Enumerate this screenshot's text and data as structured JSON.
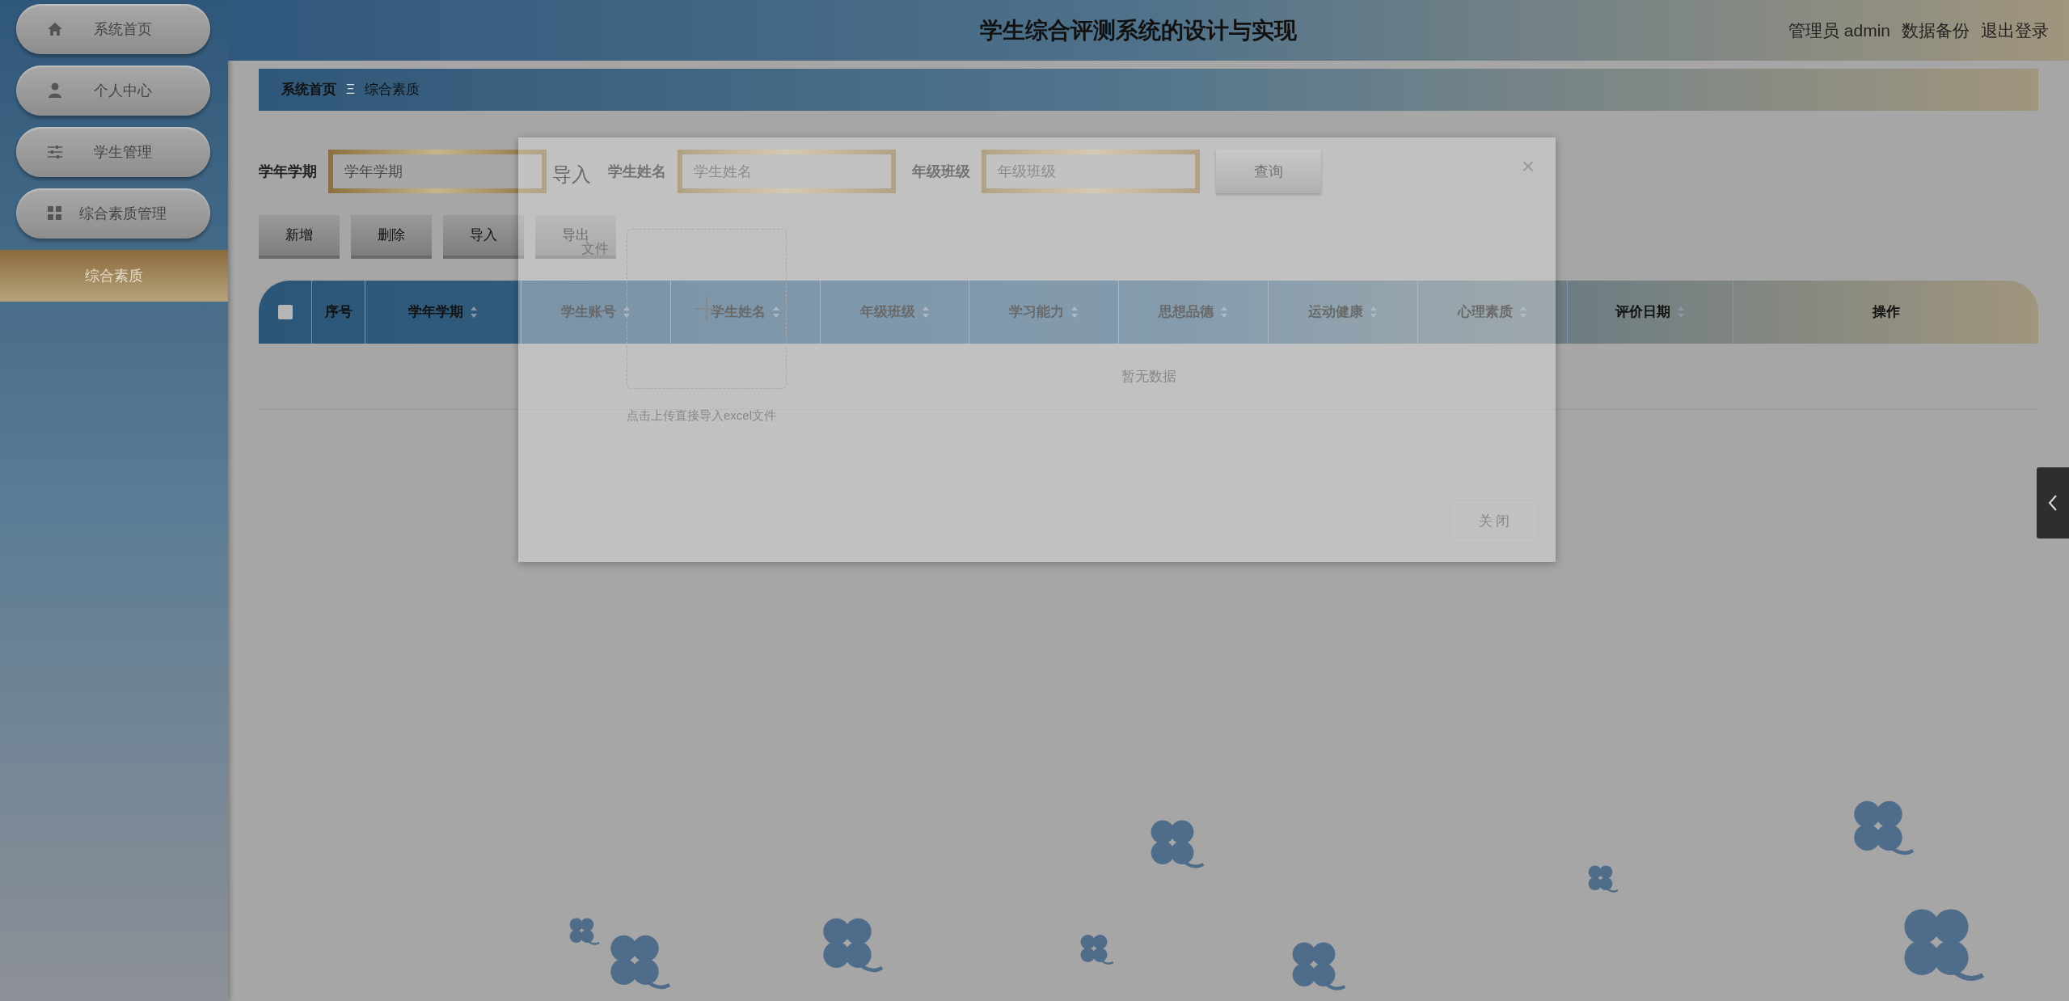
{
  "sidebar": {
    "items": [
      {
        "label": "系统首页",
        "selected": false
      },
      {
        "label": "个人中心",
        "selected": false
      },
      {
        "label": "学生管理",
        "selected": false
      },
      {
        "label": "综合素质管理",
        "selected": false,
        "children": [
          {
            "label": "综合素质",
            "selected": true
          }
        ]
      }
    ]
  },
  "header": {
    "title": "学生综合评测系统的设计与实现",
    "user": "管理员 admin",
    "links": [
      "数据备份",
      "退出登录"
    ]
  },
  "breadcrumb": {
    "items": [
      "系统首页",
      "综合素质"
    ],
    "separator": "Ξ"
  },
  "search": {
    "fields": [
      {
        "label": "学年学期",
        "placeholder": "学年学期"
      },
      {
        "label": "学生姓名",
        "placeholder": "学生姓名"
      },
      {
        "label": "年级班级",
        "placeholder": "年级班级"
      }
    ],
    "button": "查询"
  },
  "actions": [
    "新增",
    "删除",
    "导入",
    "导出"
  ],
  "table": {
    "select_all": {
      "checked": false
    },
    "columns": [
      {
        "label": "序号",
        "sortable": false
      },
      {
        "label": "学年学期",
        "sortable": true
      },
      {
        "label": "学生账号",
        "sortable": true
      },
      {
        "label": "学生姓名",
        "sortable": true
      },
      {
        "label": "年级班级",
        "sortable": true
      },
      {
        "label": "学习能力",
        "sortable": true
      },
      {
        "label": "思想品德",
        "sortable": true
      },
      {
        "label": "运动健康",
        "sortable": true
      },
      {
        "label": "心理素质",
        "sortable": true
      },
      {
        "label": "评价日期",
        "sortable": true
      },
      {
        "label": "操作",
        "sortable": false
      }
    ],
    "empty_text": "暂无数据"
  },
  "modal": {
    "title": "导入",
    "close": "×",
    "field_label": "文件",
    "upload_hint": "点击上传直接导入excel文件",
    "button": "关 闭"
  }
}
